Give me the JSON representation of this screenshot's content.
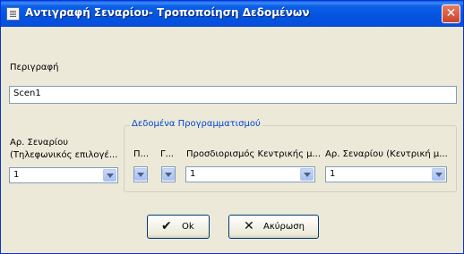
{
  "window": {
    "title": "Αντιγραφή Σεναρίου- Τροποποίηση Δεδομένων"
  },
  "form": {
    "description_label": "Περιγραφή",
    "description_value": "Scen1",
    "scenario_phone_label_line1": "Αρ. Σεναρίου",
    "scenario_phone_label_line2": "(Τηλεφωνικός επιλογέ...",
    "scenario_phone_value": "1"
  },
  "programming_group": {
    "title": "Δεδομένα Προγραμματισμού",
    "col_p_label": "Π...",
    "col_g_label": "Γ...",
    "central_label": "Προσδιορισμός Κεντρικής μ...",
    "central_value": "1",
    "scenario_central_label": "Αρ. Σεναρίου (Κεντρική μ...",
    "scenario_central_value": "1"
  },
  "buttons": {
    "ok": "Ok",
    "cancel": "Ακύρωση"
  },
  "icons": {
    "close": "close-icon",
    "ok": "check-icon",
    "cancel": "x-icon",
    "app": "window-icon"
  }
}
